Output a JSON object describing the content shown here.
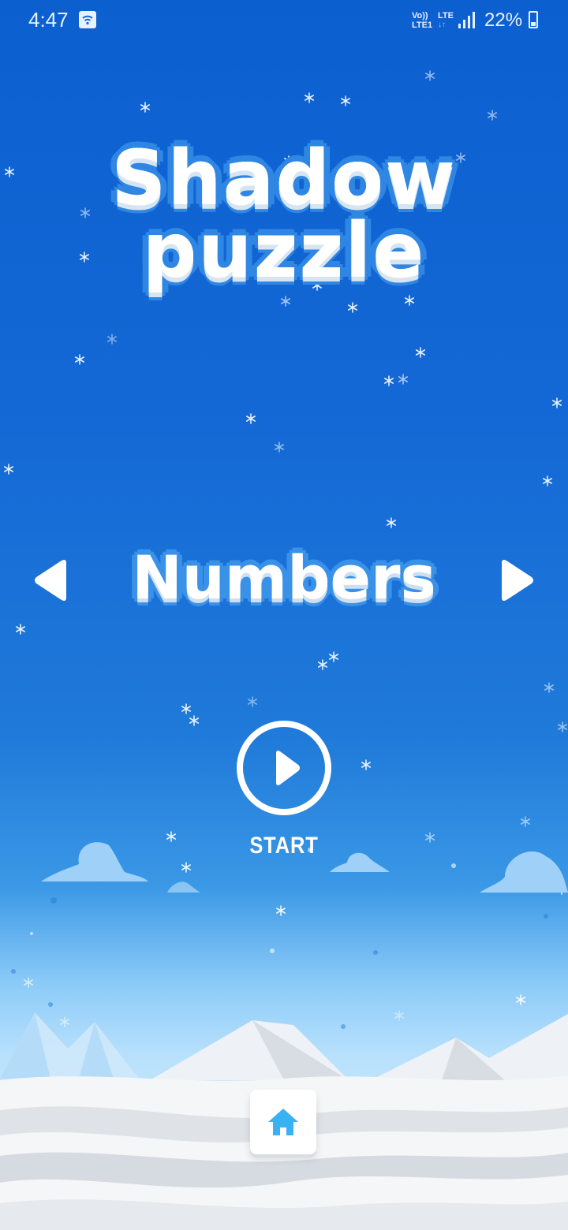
{
  "status_bar": {
    "time": "4:47",
    "volte_top": "Vo))",
    "volte_bottom": "LTE1",
    "lte_label": "LTE",
    "battery": "22%"
  },
  "title": {
    "line1": "Shadow",
    "line2": "puzzle"
  },
  "category": {
    "selected": "Numbers"
  },
  "start": {
    "label": "START"
  },
  "icons": {
    "prev": "left-arrow-icon",
    "next": "right-arrow-icon",
    "play": "play-icon",
    "home": "home-icon"
  },
  "colors": {
    "background_top": "#0b5fcf",
    "background_bottom": "#ddeefb",
    "title_outline": "#2f86e3",
    "home_icon": "#38b2f2"
  }
}
